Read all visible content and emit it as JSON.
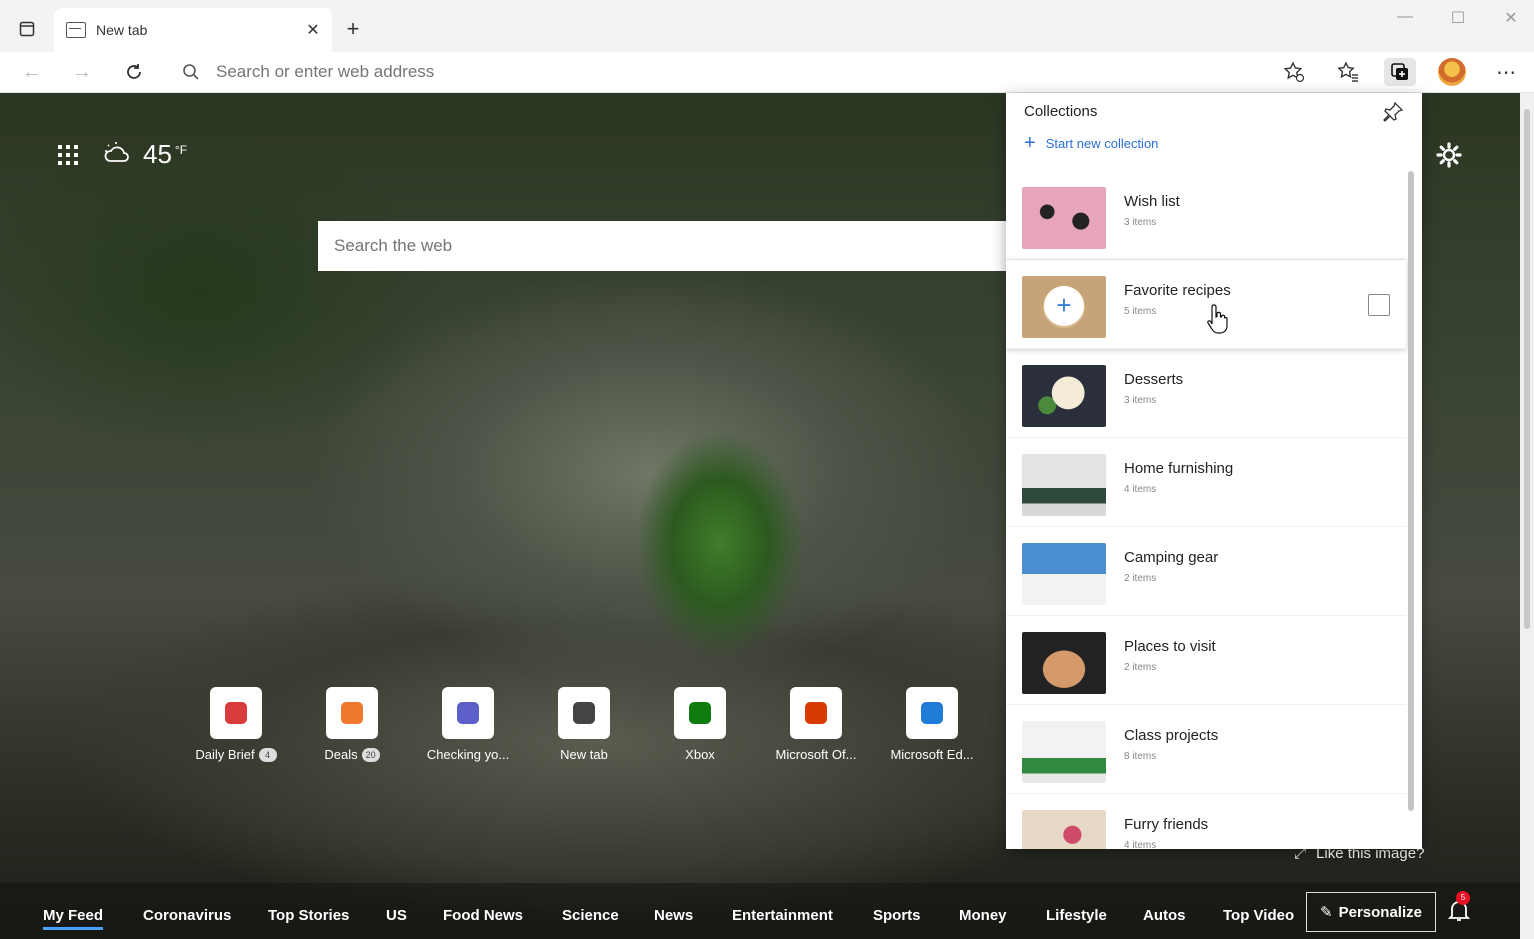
{
  "browser": {
    "tab_title": "New tab",
    "address_placeholder": "Search or enter web address"
  },
  "newtab": {
    "temperature": "45",
    "temp_unit": "°F",
    "search_placeholder": "Search the web",
    "tiles": [
      {
        "label": "Daily Brief",
        "badge": "4",
        "icon": "news-icon",
        "color": "#d83b3b"
      },
      {
        "label": "Deals",
        "badge": "20",
        "icon": "tag-icon",
        "color": "#f0782a"
      },
      {
        "label": "Checking yo...",
        "badge": "",
        "icon": "teams-icon",
        "color": "#5b5fc7"
      },
      {
        "label": "New tab",
        "badge": "",
        "icon": "newtab-icon",
        "color": "#444444"
      },
      {
        "label": "Xbox",
        "badge": "",
        "icon": "xbox-icon",
        "color": "#107c10"
      },
      {
        "label": "Microsoft Of...",
        "badge": "",
        "icon": "office-icon",
        "color": "#d83b01"
      },
      {
        "label": "Microsoft Ed...",
        "badge": "",
        "icon": "edge-icon",
        "color": "#1f7bd6"
      }
    ],
    "like_image": "Like this image?",
    "feed_nav": [
      "My Feed",
      "Coronavirus",
      "Top Stories",
      "US",
      "Food News",
      "Science",
      "News",
      "Entertainment",
      "Sports",
      "Money",
      "Lifestyle",
      "Autos",
      "Top Video"
    ],
    "personalize_label": "Personalize",
    "notification_count": "5"
  },
  "collections": {
    "title": "Collections",
    "start_new": "Start new collection",
    "items": [
      {
        "name": "Wish list",
        "count": "3 items"
      },
      {
        "name": "Favorite recipes",
        "count": "5 items"
      },
      {
        "name": "Desserts",
        "count": "3 items"
      },
      {
        "name": "Home furnishing",
        "count": "4 items"
      },
      {
        "name": "Camping gear",
        "count": "2 items"
      },
      {
        "name": "Places to visit",
        "count": "2 items"
      },
      {
        "name": "Class projects",
        "count": "8 items"
      },
      {
        "name": "Furry friends",
        "count": "4 items"
      }
    ]
  }
}
